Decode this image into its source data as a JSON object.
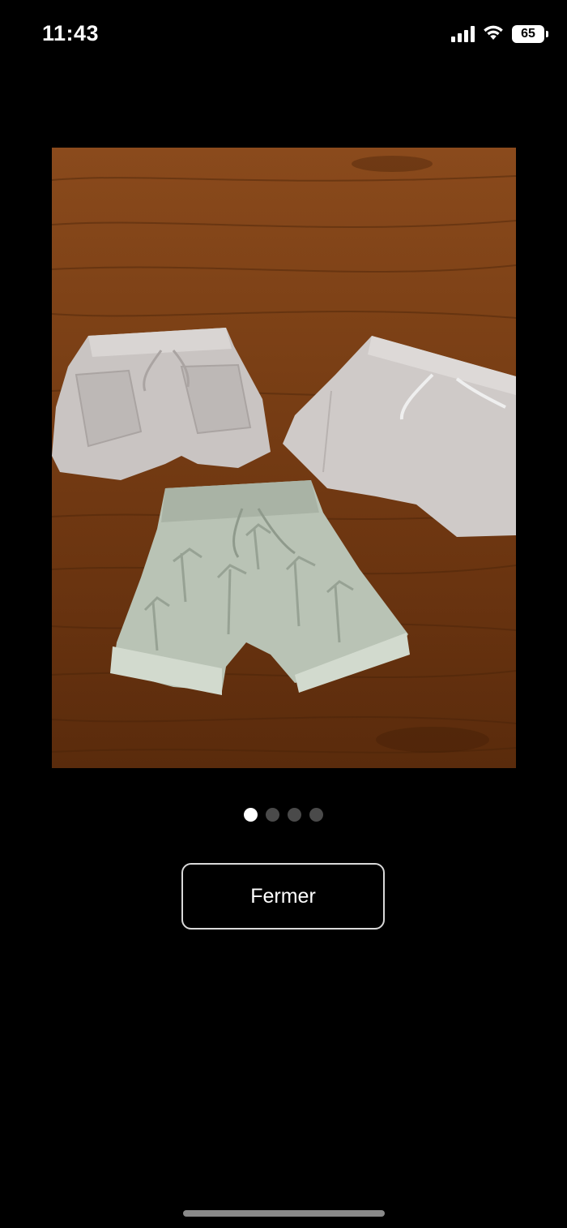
{
  "status_bar": {
    "time": "11:43",
    "battery_level": "65",
    "icons": [
      "cellular-signal-icon",
      "wifi-icon",
      "battery-icon"
    ]
  },
  "gallery": {
    "photo_description_icon": "product-photo",
    "page_count": 4,
    "active_page": 1
  },
  "actions": {
    "close_label": "Fermer"
  },
  "colors": {
    "background": "#000000",
    "dot_active": "#ffffff",
    "dot_inactive": "#4a4a4a",
    "button_border": "#d9d9d9"
  }
}
